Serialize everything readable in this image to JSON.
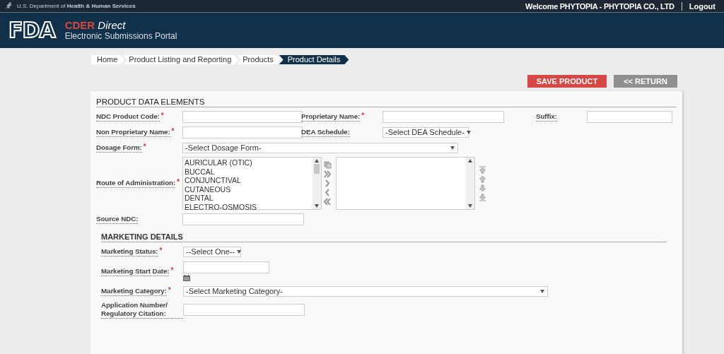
{
  "top_bar": {
    "agency": "U.S. Department of **Health & Human Services**",
    "welcome": "Welcome PHYTOPIA - PHYTOPIA CO., LTD",
    "logout": "Logout"
  },
  "brand": {
    "logo": "FDA",
    "product": "CDER",
    "product_suffix": "Direct",
    "tagline": "Electronic Submissions Portal"
  },
  "breadcrumb": [
    {
      "label": "Home",
      "selected": false
    },
    {
      "label": "Product Listing and Reporting",
      "selected": false
    },
    {
      "label": "Products",
      "selected": false
    },
    {
      "label": "Product Details",
      "selected": true
    }
  ],
  "actions": [
    {
      "label": "SAVE PRODUCT",
      "kind": "primary"
    },
    {
      "label": "<< RETURN",
      "kind": "secondary"
    }
  ],
  "required_mark": "*",
  "sections": [
    {
      "title": "PRODUCT DATA ELEMENTS",
      "rows": [
        [
          {
            "label": "NDC Product Code:",
            "required": true,
            "kind": "text"
          },
          {
            "label": "Proprietary Name:",
            "required": true,
            "kind": "text"
          },
          {
            "label": "Suffix:",
            "required": false,
            "kind": "text"
          }
        ],
        [
          {
            "label": "Non Proprietary Name:",
            "required": true,
            "kind": "text"
          },
          {
            "label": "DEA Schedule:",
            "required": false,
            "kind": "select",
            "value": "-Select DEA Schedule-"
          }
        ],
        [
          {
            "label": "Dosage Form:",
            "required": true,
            "kind": "select",
            "value": "-Select Dosage Form-"
          }
        ],
        [
          {
            "label": "Route of Administration:",
            "required": true,
            "kind": "dual-list",
            "options": [
              "AURICULAR (OTIC)",
              "BUCCAL",
              "CONJUNCTIVAL",
              "CUTANEOUS",
              "DENTAL",
              "ELECTRO-OSMOSIS"
            ]
          }
        ],
        [
          {
            "label": "Source NDC:",
            "required": false,
            "kind": "text"
          }
        ]
      ]
    },
    {
      "title": "MARKETING DETAILS",
      "rows": [
        [
          {
            "label": "Marketing Status:",
            "required": true,
            "kind": "select",
            "value": "--Select One--"
          }
        ],
        [
          {
            "label": "Marketing Start Date:",
            "required": true,
            "kind": "date"
          }
        ],
        [
          {
            "label": "Marketing Category:",
            "required": true,
            "kind": "select",
            "value": "-Select Marketing Category-"
          }
        ],
        [
          {
            "label": "Application Number/ Regulatory Citation:",
            "required": false,
            "kind": "text"
          }
        ]
      ]
    }
  ]
}
